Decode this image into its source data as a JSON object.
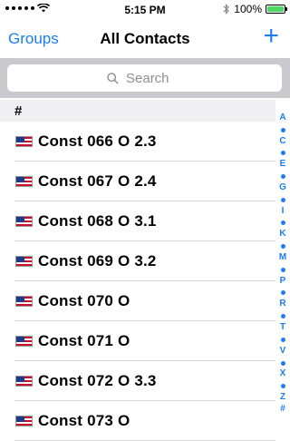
{
  "status_bar": {
    "time": "5:15 PM",
    "battery": "100%",
    "battery_level": 1.0
  },
  "nav": {
    "left_label": "Groups",
    "title": "All Contacts",
    "add_icon": "plus-icon"
  },
  "search": {
    "placeholder": "Search",
    "icon": "search-icon"
  },
  "section": {
    "header": "#"
  },
  "contacts": [
    {
      "name": "Const  066   O  2.3",
      "flag": "us-flag-icon"
    },
    {
      "name": "Const  067   O  2.4",
      "flag": "us-flag-icon"
    },
    {
      "name": "Const  068   O  3.1",
      "flag": "us-flag-icon"
    },
    {
      "name": "Const  069   O  3.2",
      "flag": "us-flag-icon"
    },
    {
      "name": "Const  070   O",
      "flag": "us-flag-icon"
    },
    {
      "name": "Const  071   O",
      "flag": "us-flag-icon"
    },
    {
      "name": "Const  072   O  3.3",
      "flag": "us-flag-icon"
    },
    {
      "name": "Const  073   O",
      "flag": "us-flag-icon"
    }
  ],
  "index_bar": [
    "A",
    "•",
    "C",
    "•",
    "E",
    "•",
    "G",
    "•",
    "I",
    "•",
    "K",
    "•",
    "M",
    "•",
    "P",
    "•",
    "R",
    "•",
    "T",
    "•",
    "V",
    "•",
    "X",
    "•",
    "Z",
    "#"
  ],
  "colors": {
    "accent": "#1e7cf5",
    "search_bg": "#c9c9ce",
    "section_bg": "#f0f0f2"
  }
}
